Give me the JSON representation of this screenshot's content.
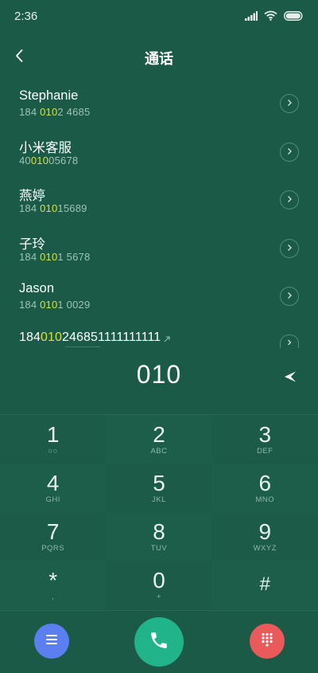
{
  "status": {
    "time": "2:36"
  },
  "header": {
    "title": "通话"
  },
  "contacts": [
    {
      "name": "Stephanie",
      "num_pre": "184 ",
      "num_hl": "010",
      "num_post": "2 4685"
    },
    {
      "name": "小米客服",
      "num_pre": "40",
      "num_hl": "010",
      "num_post": "05678"
    },
    {
      "name": "燕婷",
      "num_pre": "184 ",
      "num_hl": "010",
      "num_post": "15689"
    },
    {
      "name": "子玲",
      "num_pre": "184 ",
      "num_hl": "010",
      "num_post": "1 5678"
    },
    {
      "name": "Jason",
      "num_pre": "184 ",
      "num_hl": "010",
      "num_post": "1 0029"
    }
  ],
  "raw_number": {
    "pre": "184",
    "hl": "010",
    "post": "246851111111111"
  },
  "dial": {
    "value": "010"
  },
  "keypad": [
    [
      {
        "digit": "1",
        "letters": "○○"
      },
      {
        "digit": "2",
        "letters": "ABC"
      },
      {
        "digit": "3",
        "letters": "DEF"
      }
    ],
    [
      {
        "digit": "4",
        "letters": "GHI"
      },
      {
        "digit": "5",
        "letters": "JKL"
      },
      {
        "digit": "6",
        "letters": "MNO"
      }
    ],
    [
      {
        "digit": "7",
        "letters": "PQRS"
      },
      {
        "digit": "8",
        "letters": "TUV"
      },
      {
        "digit": "9",
        "letters": "WXYZ"
      }
    ],
    [
      {
        "digit": "*",
        "letters": ","
      },
      {
        "digit": "0",
        "letters": "+"
      },
      {
        "digit": "#",
        "letters": ""
      }
    ]
  ],
  "colors": {
    "background": "#1a5a46",
    "highlight": "#d6e23a",
    "menu": "#5b7ff0",
    "call": "#21b38a",
    "keypad_toggle": "#ea5a5a"
  }
}
